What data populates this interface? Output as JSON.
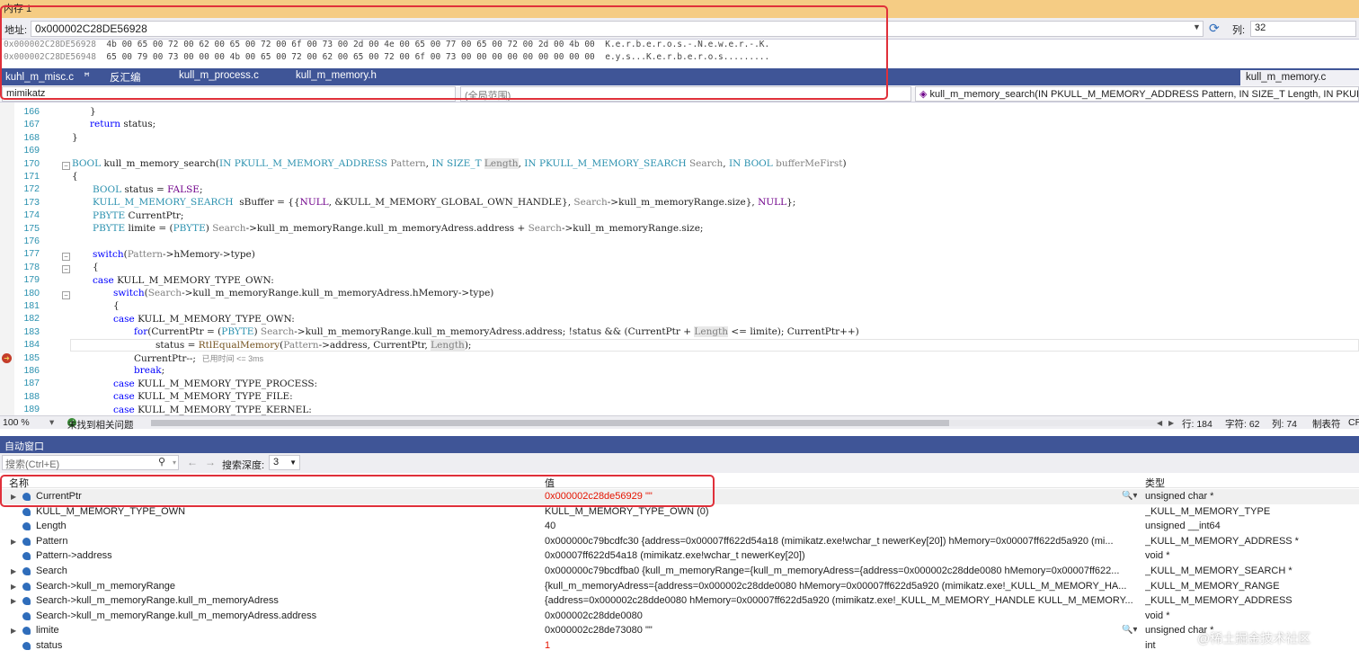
{
  "memory": {
    "title": "内存 1",
    "address_label": "地址:",
    "address_value": "0x000002C28DE56928",
    "column_label": "列:",
    "column_value": "32",
    "rows": [
      {
        "addr": "0x000002C28DE56928",
        "bytes": "4b 00 65 00 72 00 62 00 65 00 72 00 6f 00 73 00 2d 00 4e 00 65 00 77 00 65 00 72 00 2d 00 4b 00",
        "ascii": "K.e.r.b.e.r.o.s.-.N.e.w.e.r.-.K."
      },
      {
        "addr": "0x000002C28DE56948",
        "bytes": "65 00 79 00 73 00 00 00 4b 00 65 00 72 00 62 00 65 00 72 00 6f 00 73 00 00 00 00 00 00 00 00 00",
        "ascii": "e.y.s...K.e.r.b.e.r.o.s........."
      }
    ]
  },
  "tabs": [
    {
      "label": "kuhl_m_misc.c",
      "pin": "ꟸ"
    },
    {
      "label": "反汇编"
    },
    {
      "label": "kull_m_process.c"
    },
    {
      "label": "kull_m_memory.h"
    }
  ],
  "active_tab": "kull_m_memory.c",
  "nav": {
    "project": "mimikatz",
    "scope": "(全局范围)",
    "function": "kull_m_memory_search(IN PKULL_M_MEMORY_ADDRESS Pattern, IN SIZE_T Length, IN PKULL"
  },
  "code": {
    "line_numbers": [
      "166",
      "167",
      "168",
      "169",
      "170",
      "171",
      "172",
      "173",
      "174",
      "175",
      "176",
      "177",
      "178",
      "179",
      "180",
      "181",
      "182",
      "183",
      "184",
      "185",
      "186",
      "187",
      "188",
      "189"
    ],
    "elapsed": "已用时间 <= 3ms"
  },
  "editor_status": {
    "zoom": "100 %",
    "issues": "未找到相关问题",
    "line": "行: 184",
    "char": "字符: 62",
    "col": "列: 74",
    "tabs": "制表符",
    "eol": "CR"
  },
  "autos": {
    "title": "自动窗口",
    "search_placeholder": "搜索(Ctrl+E)",
    "depth_label": "搜索深度:",
    "depth_value": "3",
    "headers": {
      "name": "名称",
      "value": "值",
      "type": "类型"
    },
    "rows": [
      {
        "name": "CurrentPtr",
        "value": "0x000002c28de56929 \"\"",
        "type": "unsigned char *",
        "expand": "▶",
        "changed": true
      },
      {
        "name": "KULL_M_MEMORY_TYPE_OWN",
        "value": "KULL_M_MEMORY_TYPE_OWN (0)",
        "type": "_KULL_M_MEMORY_TYPE",
        "expand": ""
      },
      {
        "name": "Length",
        "value": "40",
        "type": "unsigned __int64",
        "expand": ""
      },
      {
        "name": "Pattern",
        "value": "0x000000c79bcdfc30 {address=0x00007ff622d54a18 (mimikatz.exe!wchar_t newerKey[20]) hMemory=0x00007ff622d5a920 (mi...",
        "type": "_KULL_M_MEMORY_ADDRESS *",
        "expand": "▶"
      },
      {
        "name": "Pattern->address",
        "value": "0x00007ff622d54a18 (mimikatz.exe!wchar_t newerKey[20])",
        "type": "void *",
        "expand": ""
      },
      {
        "name": "Search",
        "value": "0x000000c79bcdfba0 {kull_m_memoryRange={kull_m_memoryAdress={address=0x000002c28dde0080 hMemory=0x00007ff622...",
        "type": "_KULL_M_MEMORY_SEARCH *",
        "expand": "▶"
      },
      {
        "name": "Search->kull_m_memoryRange",
        "value": "{kull_m_memoryAdress={address=0x000002c28dde0080 hMemory=0x00007ff622d5a920 (mimikatz.exe!_KULL_M_MEMORY_HA...",
        "type": "_KULL_M_MEMORY_RANGE",
        "expand": "▶"
      },
      {
        "name": "Search->kull_m_memoryRange.kull_m_memoryAdress",
        "value": "{address=0x000002c28dde0080 hMemory=0x00007ff622d5a920 (mimikatz.exe!_KULL_M_MEMORY_HANDLE KULL_M_MEMORY...",
        "type": "_KULL_M_MEMORY_ADDRESS",
        "expand": "▶"
      },
      {
        "name": "Search->kull_m_memoryRange.kull_m_memoryAdress.address",
        "value": "0x000002c28dde0080",
        "type": "void *",
        "expand": ""
      },
      {
        "name": "limite",
        "value": "0x000002c28de73080 \"\"",
        "type": "unsigned char *",
        "expand": "▶"
      },
      {
        "name": "status",
        "value": "1",
        "type": "int",
        "expand": "",
        "changed": true
      }
    ]
  },
  "watermark": "@稀土掘金技术社区",
  "colors": {
    "accent": "#3f5597",
    "highlight_box": "#e0303a",
    "changed_value": "#e51400"
  }
}
